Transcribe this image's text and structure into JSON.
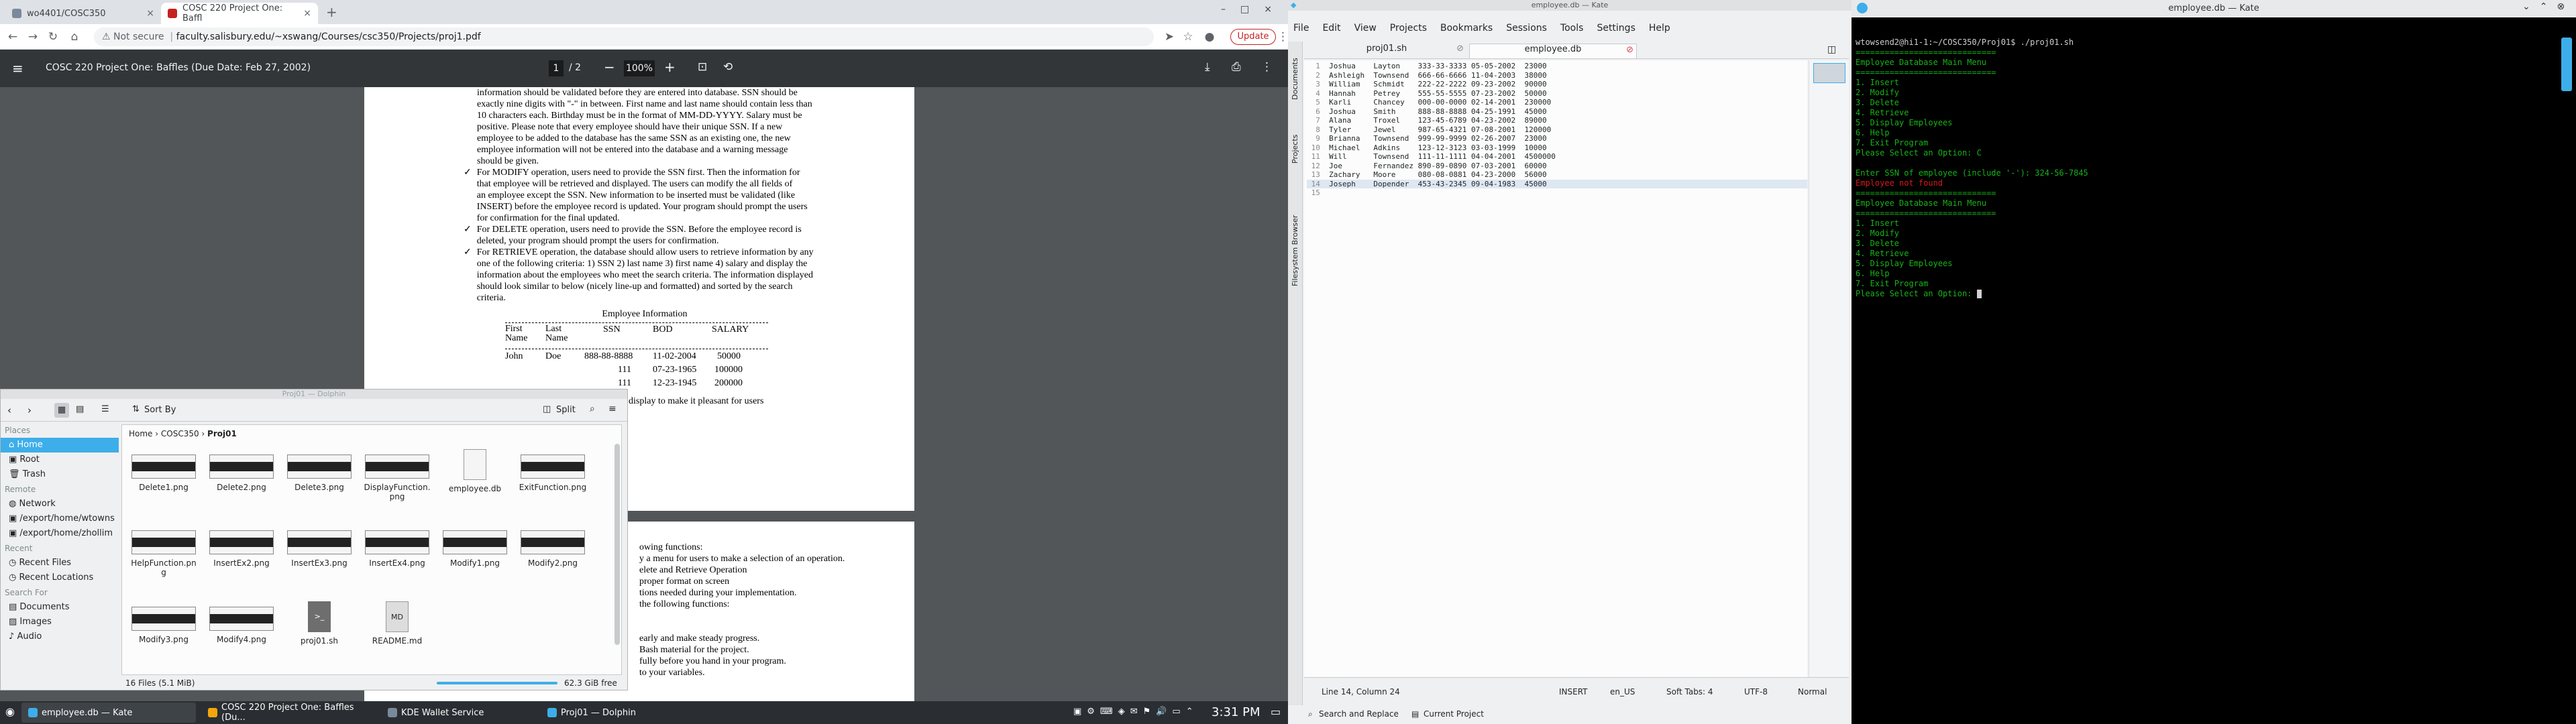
{
  "chrome": {
    "tabs": [
      {
        "label": "wo4401/COSC350"
      },
      {
        "label": "COSC 220 Project One: Baffl"
      }
    ],
    "new_tab": "+",
    "address": {
      "not_secure": "Not secure",
      "url": "faculty.salisbury.edu/~xswang/Courses/csc350/Projects/proj1.pdf"
    },
    "update_label": "Update"
  },
  "pdf": {
    "title": "COSC 220 Project One: Baffles (Due Date: Feb 27, 2002)",
    "page_current": "1",
    "page_total": "/ 2",
    "zoom": "100%",
    "page1_lines": [
      "information should be validated before they are entered into database. SSN should be",
      "exactly nine digits with \"-\" in between. First name and last name should contain less than",
      "10 characters each. Birthday must be in the format of MM-DD-YYYY. Salary must be",
      "positive. Please note that every employee should have their unique SSN.  If a new",
      "employee to be added to the database has the same SSN as an existing one, the new",
      "employee information will not be entered into the database and a warning message",
      "should be given."
    ],
    "bullets": [
      {
        "check": "✓",
        "lines": [
          "For MODIFY operation, users need to provide the SSN first. Then the information for",
          "that employee will be retrieved and displayed. The users can modify the all fields of",
          "an employee except the SSN. New information to be inserted must be validated (like",
          "INSERT) before the employee record is updated. Your program should prompt the users",
          "for confirmation for the final updated."
        ]
      },
      {
        "check": "✓",
        "lines": [
          "For DELETE operation, users need to provide the SSN. Before the employee record is",
          "deleted, your program should prompt the users for confirmation."
        ]
      },
      {
        "check": "✓",
        "lines": [
          "For RETRIEVE operation, the database should allow users to retrieve information by any",
          "one of the following criteria: 1) SSN 2) last name 3) first name 4) salary and display the",
          "information about the employees who meet the search criteria. The information displayed",
          "should look similar to below (nicely line-up and formatted) and sorted by the search",
          "criteria."
        ]
      }
    ],
    "table_title": "Employee Information",
    "table_headers": [
      "First\nName",
      "Last\nName",
      "SSN",
      "BOD",
      "SALARY"
    ],
    "table_row": [
      "John",
      "Doe",
      "888-88-8888",
      "11-02-2004",
      "50000"
    ],
    "table_rows_partial": [
      [
        "111",
        "07-23-1965",
        "100000"
      ],
      [
        "111",
        "12-23-1945",
        "200000"
      ]
    ],
    "page1_tail": "display to make it pleasant for users",
    "page2_lines": [
      "owing functions:",
      "y a menu for users to make a selection of an operation.",
      "elete and Retrieve Operation",
      "proper format on screen",
      "tions needed during your implementation.",
      "the following functions:",
      "",
      "",
      "early and make steady progress.",
      "Bash material for the project.",
      "fully before you hand in your program.",
      "to your variables."
    ]
  },
  "dolphin": {
    "title": "Proj01 — Dolphin",
    "sort_by": "Sort By",
    "split": "Split",
    "breadcrumb": [
      "Home",
      "COSC350",
      "Proj01"
    ],
    "places_header": "Places",
    "places": [
      "Home",
      "Root",
      "Trash"
    ],
    "remote_header": "Remote",
    "remote": [
      "Network",
      "/export/home/wtowns",
      "/export/home/zhollim"
    ],
    "recent_header": "Recent",
    "recent": [
      "Recent Files",
      "Recent Locations"
    ],
    "search_header": "Search For",
    "search": [
      "Documents",
      "Images",
      "Audio"
    ],
    "files": [
      "Delete1.png",
      "Delete2.png",
      "Delete3.png",
      "DisplayFunction.png",
      "employee.db",
      "ExitFunction.png",
      "HelpFunction.png",
      "InsertEx2.png",
      "InsertEx3.png",
      "InsertEx4.png",
      "Modify1.png",
      "Modify2.png",
      "Modify3.png",
      "Modify4.png",
      "proj01.sh",
      "README.md"
    ],
    "status_count": "16 Files (5.1 MiB)",
    "status_free": "62.3 GiB free"
  },
  "taskbar": {
    "tasks": [
      "employee.db — Kate",
      "COSC 220 Project One: Baffles (Du...",
      "KDE Wallet Service",
      "Proj01 — Dolphin"
    ],
    "clock": "3:31 PM"
  },
  "kate": {
    "window_title": "employee.db — Kate",
    "menu": [
      "File",
      "Edit",
      "View",
      "Projects",
      "Bookmarks",
      "Sessions",
      "Tools",
      "Settings",
      "Help"
    ],
    "tabs": [
      "proj01.sh",
      "employee.db"
    ],
    "side_tabs": [
      "Documents",
      "Projects",
      "Filesystem Browser"
    ],
    "lines": [
      "Joshua    Layton    333-33-3333 05-05-2002  23000",
      "Ashleigh  Townsend  666-66-6666 11-04-2003  38000",
      "William   Schmidt   222-22-2222 09-23-2002  90000",
      "Hannah    Petrey    555-55-5555 07-23-2002  50000",
      "Karli     Chancey   000-00-0000 02-14-2001  230000",
      "Joshua    Smith     888-88-8888 04-25-1991  45000",
      "Alana     Troxel    123-45-6789 04-23-2002  89000",
      "Tyler     Jewel     987-65-4321 07-08-2001  120000",
      "Brianna   Townsend  999-99-9999 02-26-2007  23000",
      "Michael   Adkins    123-12-3123 03-03-1999  10000",
      "Will      Townsend  111-11-1111 04-04-2001  4500000",
      "Joe       Fernandez 890-89-0890 07-03-2001  60000",
      "Zachary   Moore     080-08-0881 04-23-2000  56000",
      "Joseph    Dopender  453-43-2345 09-04-1983  45000",
      ""
    ],
    "status": {
      "position": "Line 14, Column 24",
      "mode": "INSERT",
      "lang": "en_US",
      "tabs": "Soft Tabs: 4",
      "encoding": "UTF-8",
      "mode2": "Normal"
    },
    "bottom": [
      "Search and Replace",
      "Current Project"
    ]
  },
  "terminal": {
    "prompt": "wtowsend2@hi1-1:~/COSC350/Proj01$ ./proj01.sh",
    "sep": "=============================",
    "menu_title": "Employee Database Main Menu",
    "options": [
      "1. Insert",
      "2. Modify",
      "3. Delete",
      "4. Retrieve",
      "5. Display Employees",
      "6. Help",
      "7. Exit Program"
    ],
    "select1": "Please Select an Option: C",
    "enter_ssn": "Enter SSN of employee (include '-'): 324-56-7845",
    "not_found": "Employee not found",
    "select2": "Please Select an Option: "
  }
}
